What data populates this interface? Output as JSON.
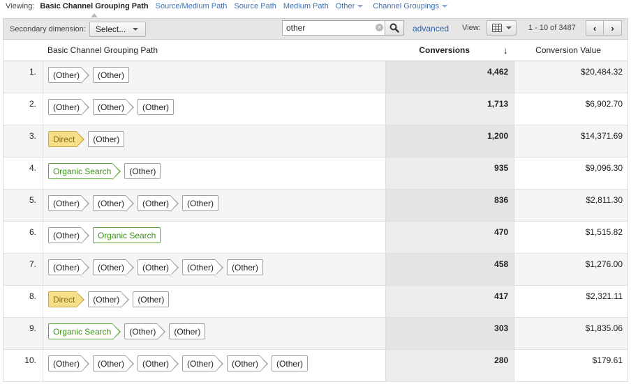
{
  "viewing": {
    "label": "Viewing:",
    "links": [
      {
        "label": "Basic Channel Grouping Path",
        "active": true,
        "dropdown": false
      },
      {
        "label": "Source/Medium Path",
        "active": false,
        "dropdown": false
      },
      {
        "label": "Source Path",
        "active": false,
        "dropdown": false
      },
      {
        "label": "Medium Path",
        "active": false,
        "dropdown": false
      },
      {
        "label": "Other",
        "active": false,
        "dropdown": true
      },
      {
        "label": "Channel Groupings",
        "active": false,
        "dropdown": true
      }
    ]
  },
  "toolbar": {
    "secondary_label": "Secondary dimension:",
    "select_label": "Select...",
    "search_value": "other",
    "advanced_label": "advanced",
    "view_label": "View:",
    "range_text": "1 - 10 of 3487",
    "prev_label": "‹",
    "next_label": "›"
  },
  "table": {
    "headers": {
      "path": "Basic Channel Grouping Path",
      "conversions": "Conversions",
      "sort_indicator": "↓",
      "value": "Conversion Value"
    },
    "rows": [
      {
        "num": "1.",
        "path": [
          "(Other)",
          "(Other)"
        ],
        "conversions": "4,462",
        "value": "$20,484.32"
      },
      {
        "num": "2.",
        "path": [
          "(Other)",
          "(Other)",
          "(Other)"
        ],
        "conversions": "1,713",
        "value": "$6,902.70"
      },
      {
        "num": "3.",
        "path": [
          "Direct",
          "(Other)"
        ],
        "conversions": "1,200",
        "value": "$14,371.69"
      },
      {
        "num": "4.",
        "path": [
          "Organic Search",
          "(Other)"
        ],
        "conversions": "935",
        "value": "$9,096.30"
      },
      {
        "num": "5.",
        "path": [
          "(Other)",
          "(Other)",
          "(Other)",
          "(Other)"
        ],
        "conversions": "836",
        "value": "$2,811.30"
      },
      {
        "num": "6.",
        "path": [
          "(Other)",
          "Organic Search"
        ],
        "conversions": "470",
        "value": "$1,515.82"
      },
      {
        "num": "7.",
        "path": [
          "(Other)",
          "(Other)",
          "(Other)",
          "(Other)",
          "(Other)"
        ],
        "conversions": "458",
        "value": "$1,276.00"
      },
      {
        "num": "8.",
        "path": [
          "Direct",
          "(Other)",
          "(Other)"
        ],
        "conversions": "417",
        "value": "$2,321.11"
      },
      {
        "num": "9.",
        "path": [
          "Organic Search",
          "(Other)",
          "(Other)"
        ],
        "conversions": "303",
        "value": "$1,835.06"
      },
      {
        "num": "10.",
        "path": [
          "(Other)",
          "(Other)",
          "(Other)",
          "(Other)",
          "(Other)",
          "(Other)"
        ],
        "conversions": "280",
        "value": "$179.61"
      }
    ]
  },
  "colors": {
    "link": "#3b70b3",
    "direct_fill": "#f6df89",
    "direct_border": "#c9a84b",
    "organic_border": "#5fa83a",
    "organic_text": "#3f8f1f"
  }
}
